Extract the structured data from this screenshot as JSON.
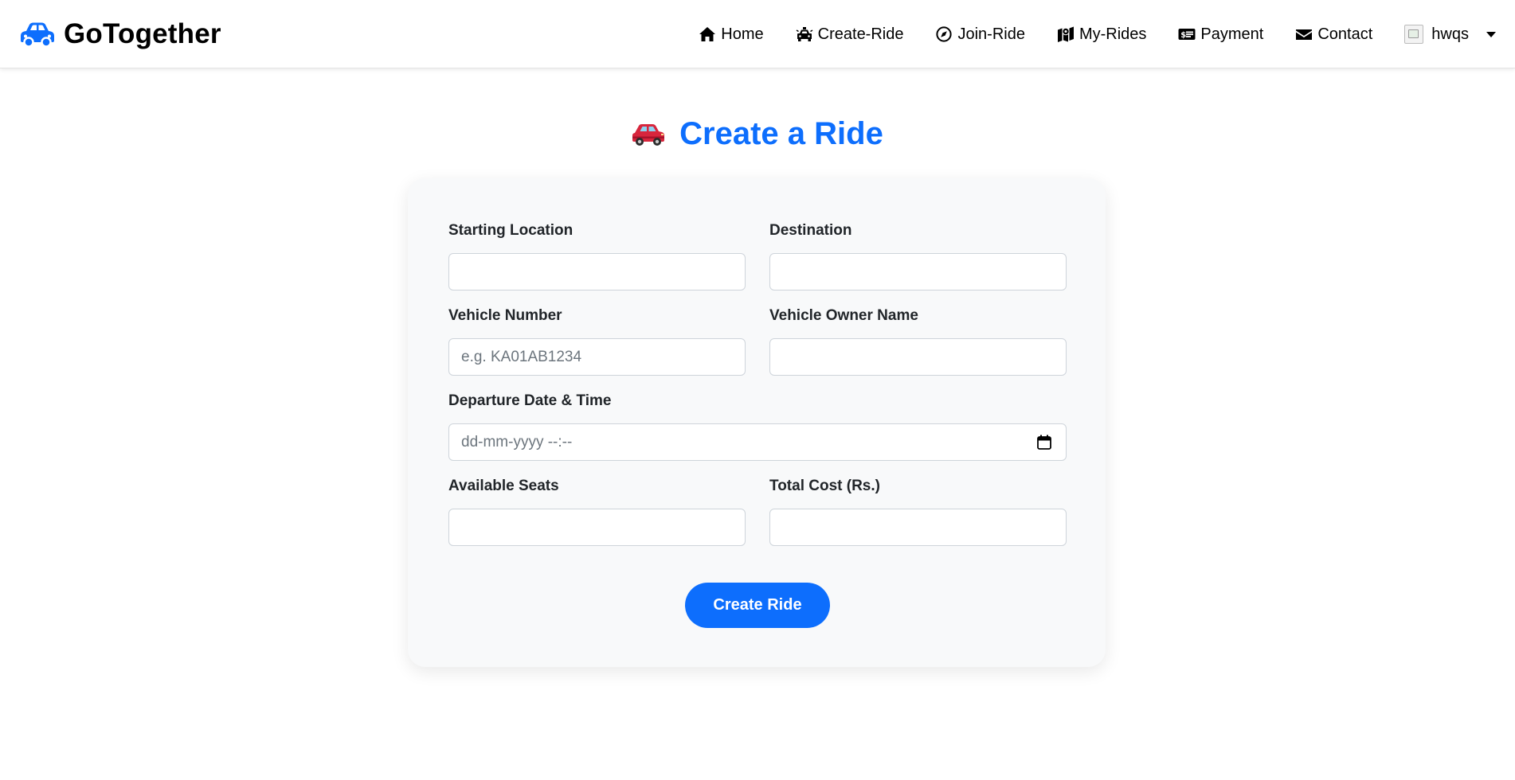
{
  "app": {
    "brand": "GoTogether",
    "brand_icon": "car-icon",
    "brand_color": "#0d6efd"
  },
  "nav": {
    "items": [
      {
        "label": "Home",
        "icon": "home-icon"
      },
      {
        "label": "Create-Ride",
        "icon": "taxi-icon"
      },
      {
        "label": "Join-Ride",
        "icon": "compass-icon"
      },
      {
        "label": "My-Rides",
        "icon": "map-icon"
      },
      {
        "label": "Payment",
        "icon": "money-bill-icon"
      },
      {
        "label": "Contact",
        "icon": "envelope-icon"
      }
    ],
    "user": {
      "name": "hwqs",
      "avatar": "broken-image-avatar",
      "menu_icon": "caret-down-icon"
    }
  },
  "page": {
    "title": "Create a Ride",
    "title_icon": "red-car-emoji",
    "accent": "#0d6efd"
  },
  "form": {
    "starting_location": {
      "label": "Starting Location",
      "value": "",
      "placeholder": ""
    },
    "destination": {
      "label": "Destination",
      "value": "",
      "placeholder": ""
    },
    "vehicle_number": {
      "label": "Vehicle Number",
      "value": "",
      "placeholder": "e.g. KA01AB1234"
    },
    "vehicle_owner_name": {
      "label": "Vehicle Owner Name",
      "value": "",
      "placeholder": ""
    },
    "departure": {
      "label": "Departure Date & Time",
      "display": "dd-mm-yyyy --:--",
      "icon": "calendar-icon"
    },
    "available_seats": {
      "label": "Available Seats",
      "value": "",
      "placeholder": ""
    },
    "total_cost": {
      "label": "Total Cost (Rs.)",
      "value": "",
      "placeholder": ""
    },
    "submit_label": "Create Ride"
  }
}
